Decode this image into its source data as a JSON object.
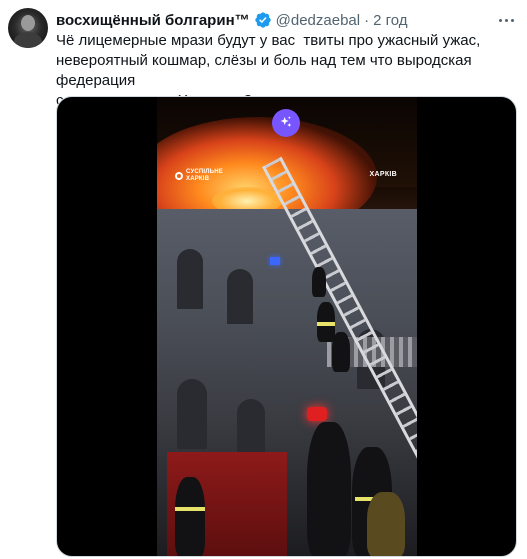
{
  "author": {
    "display_name": "восхищённый болгарин",
    "trademark": "™",
    "handle": "@dedzaebal",
    "separator": "·",
    "time": "2 год",
    "verified_icon": "verified-badge-icon",
    "verified_color": "#1d9bf0"
  },
  "tweet": {
    "text": "Чё лицемерные мрази будут у вас  твиты про ужасный ужас,\nневероятный кошмар, слёзы и боль над тем что выродская федерация\nсделала ночью в Харькове?"
  },
  "media": {
    "watermark_left_line1": "СУСПІЛЬНЕ",
    "watermark_left_line2": "ХАРКІВ",
    "watermark_right": "ХАРКІВ",
    "badge_icon": "sparkle-icon",
    "badge_color": "#7856ff"
  },
  "menu": {
    "icon": "more-options-icon"
  }
}
